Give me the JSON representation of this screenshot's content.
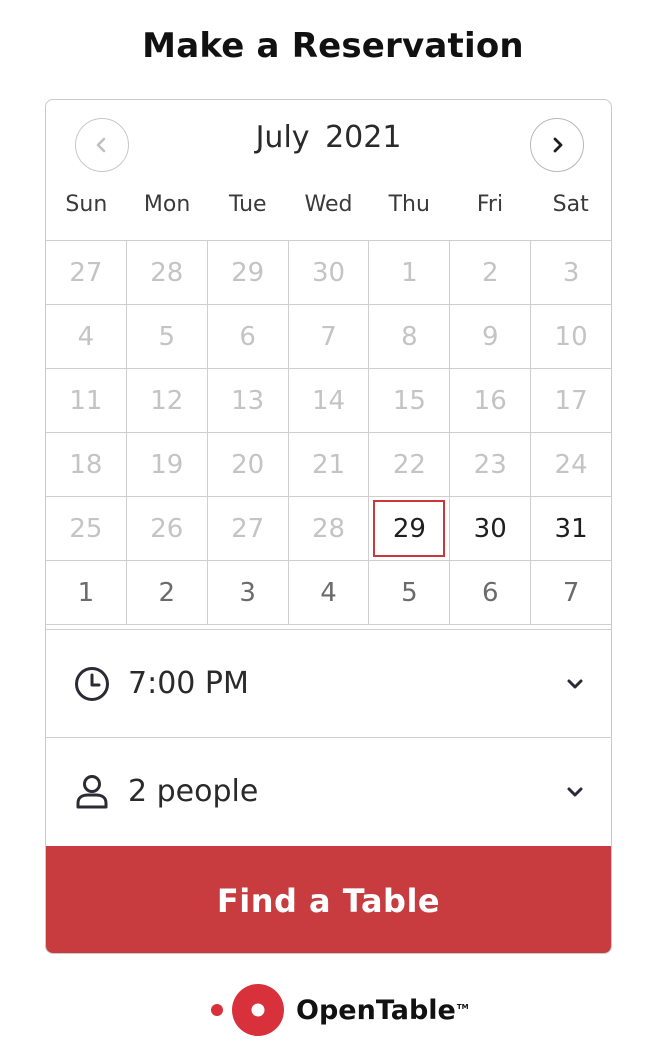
{
  "page": {
    "title": "Make a Reservation"
  },
  "calendar": {
    "month_label": "July  2021",
    "prev_icon": "chevron-left-icon",
    "next_icon": "chevron-right-icon",
    "weekdays": [
      "Sun",
      "Mon",
      "Tue",
      "Wed",
      "Thu",
      "Fri",
      "Sat"
    ],
    "weeks": [
      [
        {
          "label": "27",
          "state": "disabled"
        },
        {
          "label": "28",
          "state": "disabled"
        },
        {
          "label": "29",
          "state": "disabled"
        },
        {
          "label": "30",
          "state": "disabled"
        },
        {
          "label": "1",
          "state": "disabled"
        },
        {
          "label": "2",
          "state": "disabled"
        },
        {
          "label": "3",
          "state": "disabled"
        }
      ],
      [
        {
          "label": "4",
          "state": "disabled"
        },
        {
          "label": "5",
          "state": "disabled"
        },
        {
          "label": "6",
          "state": "disabled"
        },
        {
          "label": "7",
          "state": "disabled"
        },
        {
          "label": "8",
          "state": "disabled"
        },
        {
          "label": "9",
          "state": "disabled"
        },
        {
          "label": "10",
          "state": "disabled"
        }
      ],
      [
        {
          "label": "11",
          "state": "disabled"
        },
        {
          "label": "12",
          "state": "disabled"
        },
        {
          "label": "13",
          "state": "disabled"
        },
        {
          "label": "14",
          "state": "disabled"
        },
        {
          "label": "15",
          "state": "disabled"
        },
        {
          "label": "16",
          "state": "disabled"
        },
        {
          "label": "17",
          "state": "disabled"
        }
      ],
      [
        {
          "label": "18",
          "state": "disabled"
        },
        {
          "label": "19",
          "state": "disabled"
        },
        {
          "label": "20",
          "state": "disabled"
        },
        {
          "label": "21",
          "state": "disabled"
        },
        {
          "label": "22",
          "state": "disabled"
        },
        {
          "label": "23",
          "state": "disabled"
        },
        {
          "label": "24",
          "state": "disabled"
        }
      ],
      [
        {
          "label": "25",
          "state": "disabled"
        },
        {
          "label": "26",
          "state": "disabled"
        },
        {
          "label": "27",
          "state": "disabled"
        },
        {
          "label": "28",
          "state": "disabled"
        },
        {
          "label": "29",
          "state": "selected"
        },
        {
          "label": "30",
          "state": "available"
        },
        {
          "label": "31",
          "state": "available"
        }
      ],
      [
        {
          "label": "1",
          "state": "other"
        },
        {
          "label": "2",
          "state": "other"
        },
        {
          "label": "3",
          "state": "other"
        },
        {
          "label": "4",
          "state": "other"
        },
        {
          "label": "5",
          "state": "other"
        },
        {
          "label": "6",
          "state": "other"
        },
        {
          "label": "7",
          "state": "other"
        }
      ]
    ]
  },
  "time_select": {
    "icon": "clock-icon",
    "value": "7:00 PM",
    "chevron": "chevron-down-icon"
  },
  "party_select": {
    "icon": "person-icon",
    "value": "2 people",
    "chevron": "chevron-down-icon"
  },
  "find_button": {
    "label": "Find a Table"
  },
  "branding": {
    "logo_icon": "opentable-logo-icon",
    "name": "OpenTable",
    "trademark": "TM"
  },
  "colors": {
    "accent": "#c83c40",
    "selected_border": "#c8383d",
    "disabled_text": "#c4c4c4"
  }
}
